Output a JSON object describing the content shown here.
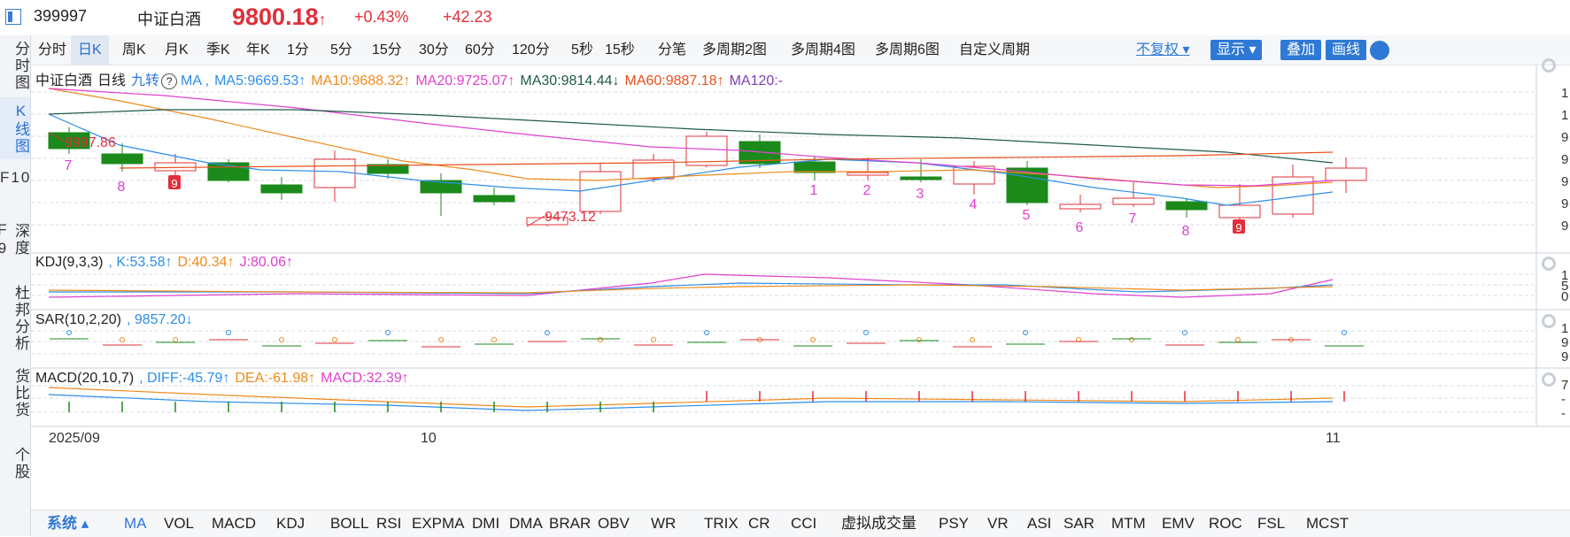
{
  "header": {
    "code": "399997",
    "name": "中证白酒",
    "price": "9800.18",
    "price_arrow": "↑",
    "change_pct": "+0.43%",
    "change_val": "+42.23"
  },
  "rail": {
    "items": [
      "分时图",
      "K线图",
      "F10",
      "深度F9",
      "杜邦分析",
      "货比货",
      "个股"
    ]
  },
  "periods": [
    "分时",
    "日K",
    "周K",
    "月K",
    "季K",
    "年K",
    "1分",
    "5分",
    "15分",
    "30分",
    "60分",
    "120分",
    "5秒",
    "15秒",
    "分笔",
    "多周期2图",
    "多周期4图",
    "多周期6图",
    "自定义周期"
  ],
  "toolbar": {
    "fuquan": "不复权",
    "show": "显示",
    "overlay": "叠加",
    "draw": "画线"
  },
  "main_legend": {
    "title": "中证白酒",
    "period": "日线",
    "jiuzhuan": "九转",
    "help": "?",
    "ma": "MA ,",
    "ma5": "MA5:9669.53↑",
    "ma10": "MA10:9688.32↑",
    "ma20": "MA20:9725.07↑",
    "ma30": "MA30:9814.44↓",
    "ma60": "MA60:9887.18↑",
    "ma120": "MA120:-",
    "high_label": "9997.86",
    "low_label": "9473.12",
    "axis_right": [
      "1",
      "1",
      "9",
      "9",
      "9",
      "9",
      "9"
    ]
  },
  "kdj_legend": {
    "name": "KDJ(9,3,3)",
    "k": ", K:53.58↑",
    "d": "D:40.34↑",
    "j": "J:80.06↑",
    "axis_right": [
      "1",
      "5",
      "0"
    ]
  },
  "sar_legend": {
    "name": "SAR(10,2,20)",
    "value": ", 9857.20↓",
    "axis_right": [
      "1",
      "9",
      "9"
    ]
  },
  "macd_legend": {
    "name": "MACD(20,10,7)",
    "diff": ", DIFF:-45.79↑",
    "dea": "DEA:-61.98↑",
    "macd": "MACD:32.39↑",
    "axis_right": [
      "7",
      "-",
      "-"
    ]
  },
  "xaxis": [
    "2025/09",
    "10",
    "11"
  ],
  "nine_turn_labels": [
    "7",
    "8",
    "9",
    "1",
    "2",
    "3",
    "4",
    "5",
    "6",
    "7",
    "8",
    "9"
  ],
  "indicators": {
    "system": "系统",
    "items": [
      "MA",
      "VOL",
      "MACD",
      "KDJ",
      "BOLL",
      "RSI",
      "EXPMA",
      "DMI",
      "DMA",
      "BRAR",
      "OBV",
      "WR",
      "TRIX",
      "CR",
      "CCI",
      "虚拟成交量",
      "PSY",
      "VR",
      "ASI",
      "SAR",
      "MTM",
      "EMV",
      "ROC",
      "FSL",
      "MCST"
    ]
  },
  "colors": {
    "up": "#e0303b",
    "down": "#1b8a1b",
    "ma5": "#2d8ee8",
    "ma10": "#f08a1c",
    "ma20": "#e040d0",
    "ma30": "#1f5a4a",
    "ma60": "#e8501c",
    "ma120": "#7b3fb3",
    "accent": "#2f79d6"
  }
}
